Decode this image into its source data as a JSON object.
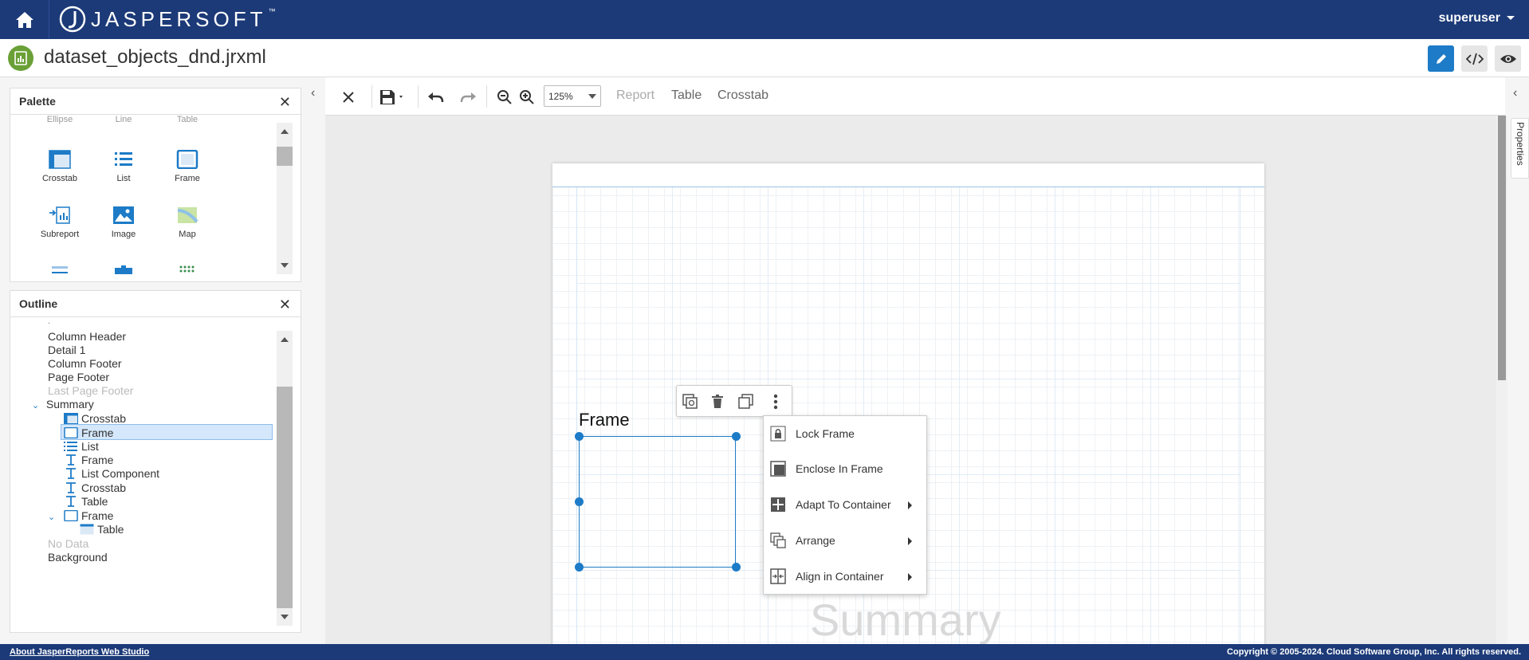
{
  "header": {
    "logo_text": "JASPERSOFT",
    "logo_tm": "™",
    "user": "superuser"
  },
  "titlebar": {
    "file_name": "dataset_objects_dnd.jrxml"
  },
  "palette": {
    "title": "Palette",
    "cut_top": [
      "Ellipse",
      "Line",
      "Table"
    ],
    "items": [
      {
        "label": "Crosstab",
        "icon": "crosstab-icon"
      },
      {
        "label": "List",
        "icon": "list-icon"
      },
      {
        "label": "Frame",
        "icon": "frame-icon"
      },
      {
        "label": "Subreport",
        "icon": "subreport-icon"
      },
      {
        "label": "Image",
        "icon": "image-icon"
      },
      {
        "label": "Map",
        "icon": "map-icon"
      }
    ]
  },
  "outline": {
    "title": "Outline",
    "rows": [
      {
        "label": "Column Header",
        "level": 0,
        "disabled": false
      },
      {
        "label": "Detail 1",
        "level": 0,
        "disabled": false
      },
      {
        "label": "Column Footer",
        "level": 0,
        "disabled": false
      },
      {
        "label": "Page Footer",
        "level": 0,
        "disabled": false
      },
      {
        "label": "Last Page Footer",
        "level": 0,
        "disabled": true
      },
      {
        "label": "Summary",
        "level": 0,
        "disabled": false,
        "expanded": true
      },
      {
        "label": "Crosstab",
        "level": 1,
        "icon": "crosstab"
      },
      {
        "label": "Frame",
        "level": 1,
        "icon": "frame",
        "selected": true
      },
      {
        "label": "List",
        "level": 1,
        "icon": "list"
      },
      {
        "label": "Frame",
        "level": 1,
        "icon": "text"
      },
      {
        "label": "List Component",
        "level": 1,
        "icon": "text"
      },
      {
        "label": "Crosstab",
        "level": 1,
        "icon": "text"
      },
      {
        "label": "Table",
        "level": 1,
        "icon": "text"
      },
      {
        "label": "Frame",
        "level": 1,
        "icon": "frame",
        "expanded": true
      },
      {
        "label": "Table",
        "level": 2,
        "icon": "table"
      },
      {
        "label": "No Data",
        "level": 0,
        "disabled": true
      },
      {
        "label": "Background",
        "level": 0,
        "disabled": false
      }
    ]
  },
  "toolbar": {
    "zoom": "125%",
    "tabs": [
      "Report",
      "Table",
      "Crosstab"
    ]
  },
  "canvas": {
    "frame_label": "Frame",
    "watermark": "Summary"
  },
  "context_menu": [
    {
      "label": "Lock Frame",
      "submenu": false,
      "icon": "lock-icon"
    },
    {
      "label": "Enclose In Frame",
      "submenu": false,
      "icon": "enclose-icon"
    },
    {
      "label": "Adapt To Container",
      "submenu": true,
      "icon": "adapt-icon"
    },
    {
      "label": "Arrange",
      "submenu": true,
      "icon": "arrange-icon"
    },
    {
      "label": "Align in Container",
      "submenu": true,
      "icon": "align-icon"
    }
  ],
  "properties_tab": "Properties",
  "footer": {
    "link": "About JasperReports Web Studio",
    "copyright": "Copyright © 2005-2024. Cloud Software Group, Inc. All rights reserved."
  },
  "colors": {
    "brand": "#1c3a78",
    "accent": "#1d7bc7",
    "file_icon": "#6aa036"
  }
}
